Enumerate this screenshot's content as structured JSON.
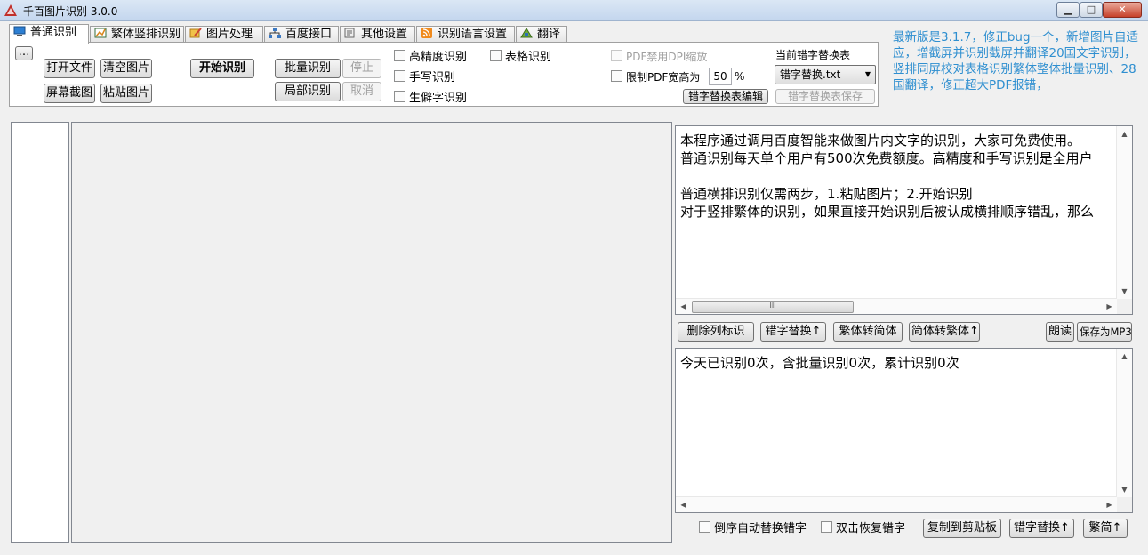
{
  "window": {
    "title": "千百图片识别 3.0.0",
    "min_label": "▁",
    "max_label": "□",
    "close_label": "✕"
  },
  "tabs": [
    {
      "label": "普通识别",
      "icon": "monitor-icon",
      "active": true
    },
    {
      "label": "繁体竖排识别",
      "icon": "chart-icon",
      "active": false
    },
    {
      "label": "图片处理",
      "icon": "edit-image-icon",
      "active": false
    },
    {
      "label": "百度接口",
      "icon": "network-icon",
      "active": false
    },
    {
      "label": "其他设置",
      "icon": "settings-doc-icon",
      "active": false
    },
    {
      "label": "识别语言设置",
      "icon": "rss-icon",
      "active": false
    },
    {
      "label": "翻译",
      "icon": "translate-icon",
      "active": false
    }
  ],
  "toolbar": {
    "more_label": "…",
    "open_file": "打开文件",
    "clear_image": "清空图片",
    "screenshot": "屏幕截图",
    "paste_image": "粘贴图片",
    "start_ocr": "开始识别",
    "batch_ocr": "批量识别",
    "stop": "停止",
    "partial_ocr": "局部识别",
    "cancel": "取消"
  },
  "options": {
    "high_precision": "高精度识别",
    "table_ocr": "表格识别",
    "handwriting": "手写识别",
    "rare_chars": "生僻字识别",
    "pdf_dpi": "PDF禁用DPI缩放",
    "pdf_limit": "限制PDF宽高为",
    "pdf_limit_value": "50",
    "pdf_limit_unit": "%",
    "replace_table_title": "当前错字替换表",
    "replace_table_selected": "错字替换.txt",
    "replace_table_edit": "错字替换表编辑",
    "replace_table_save": "错字替换表保存"
  },
  "notice": "最新版是3.1.7，修正bug一个，新增图片自适应，增截屏并识别截屏并翻译20国文字识别，竖排同屏校对表格识别繁体整体批量识别、28国翻译，修正超大PDF报错，",
  "result_text": "本程序通过调用百度智能来做图片内文字的识别，大家可免费使用。\n普通识别每天单个用户有500次免费额度。高精度和手写识别是全用户\n\n普通横排识别仅需两步，1.粘贴图片；2.开始识别\n对于竖排繁体的识别，如果直接开始识别后被认成横排顺序错乱，那么",
  "midbar": {
    "delete_markers": "删除列标识",
    "replace_errors": "错字替换↑",
    "trad_to_simp": "繁体转简体",
    "simp_to_trad": "简体转繁体↑",
    "read_aloud": "朗读",
    "save_mp3": "保存为MP3"
  },
  "stats_text": "今天已识别0次，含批量识别0次，累计识别0次",
  "bottombar": {
    "reverse_auto_replace": "倒序自动替换错字",
    "dblclick_restore": "双击恢复错字",
    "copy_clipboard": "复制到剪贴板",
    "replace_errors": "错字替换↑",
    "trad_simp": "繁简↑"
  },
  "scroll": {
    "up": "▲",
    "down": "▼",
    "left": "◀",
    "right": "▶",
    "grip": "III"
  }
}
